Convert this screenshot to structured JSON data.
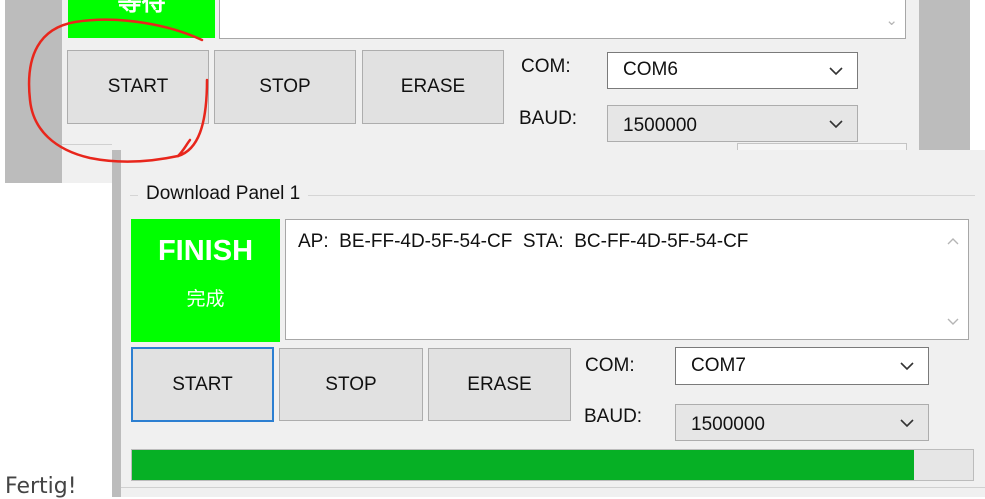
{
  "panel_top": {
    "status_label": "等待",
    "buttons": {
      "start": "START",
      "stop": "STOP",
      "erase": "ERASE"
    },
    "com_label": "COM:",
    "com_value": "COM6",
    "baud_label": "BAUD:",
    "baud_value": "1500000"
  },
  "panel_main": {
    "group_title": "Download Panel 1",
    "status_title": "FINISH",
    "status_subtitle": "完成",
    "log_text": "AP:  BE-FF-4D-5F-54-CF  STA:  BC-FF-4D-5F-54-CF",
    "buttons": {
      "start": "START",
      "stop": "STOP",
      "erase": "ERASE"
    },
    "com_label": "COM:",
    "com_value": "COM7",
    "baud_label": "BAUD:",
    "baud_value": "1500000",
    "progress": 0.93
  },
  "caption": "Fertig!",
  "colors": {
    "status_green": "#00ff00",
    "progress_green": "#06b025",
    "focus_blue": "#2c7fd1",
    "annotation_red": "#e8261c"
  },
  "icons": {
    "chevron_down": "chevron-down-icon",
    "chevron_up": "chevron-up-icon"
  }
}
